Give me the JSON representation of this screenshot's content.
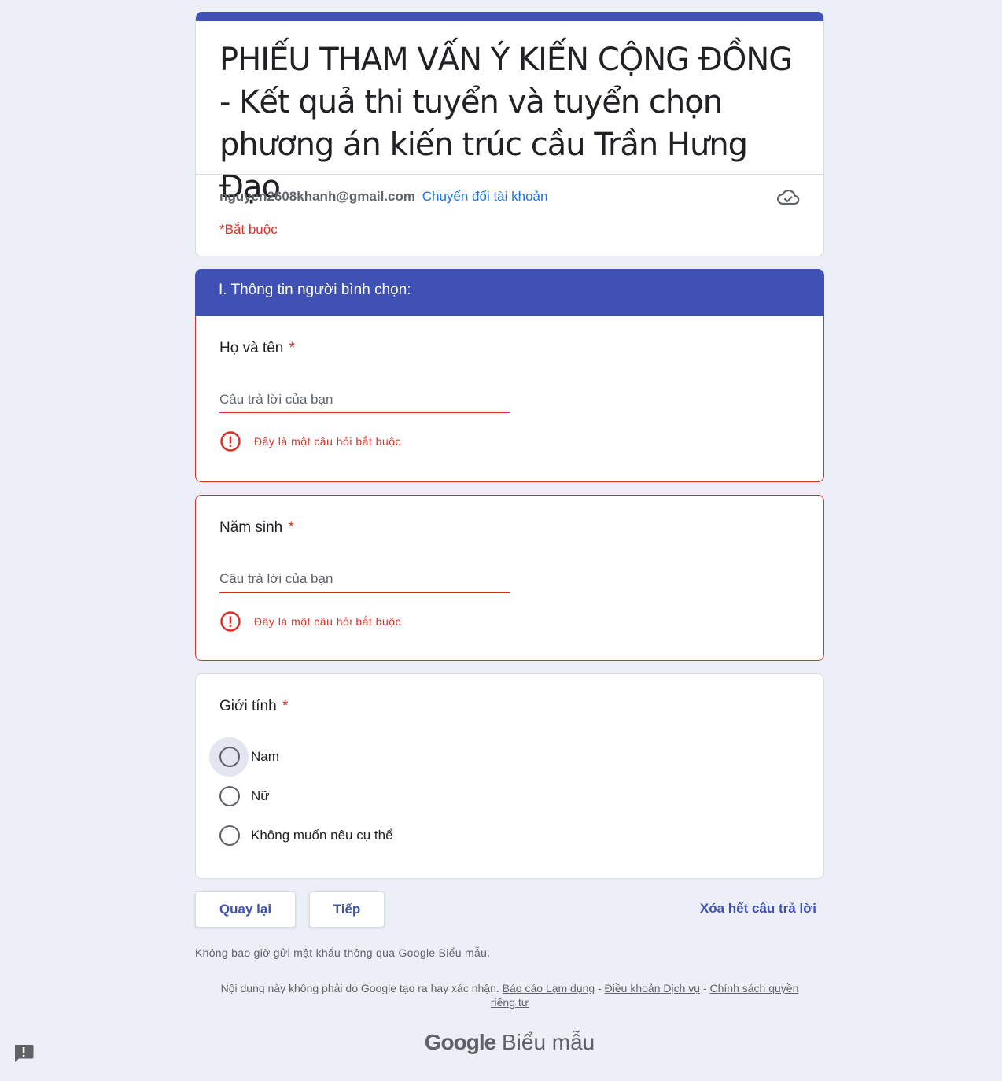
{
  "header": {
    "title": "PHIẾU THAM VẤN Ý KIẾN CỘNG ĐỒNG - Kết quả thi tuyển và tuyển chọn phương án kiến trúc cầu Trần Hưng Đạo",
    "account_email": "nguyen2608khanh@gmail.com",
    "switch_account": "Chuyển đổi tài khoản",
    "required_note": "*Bắt buộc",
    "cloud_icon": "cloud-check-icon"
  },
  "section": {
    "title": "I. Thông tin người bình chọn:"
  },
  "questions": [
    {
      "title": "Họ và tên",
      "required_mark": "*",
      "placeholder": "Câu trả lời của bạn",
      "value": "",
      "error": "Đây là một câu hỏi bắt buộc"
    },
    {
      "title": "Năm sinh",
      "required_mark": "*",
      "placeholder": "Câu trả lời của bạn",
      "value": "",
      "error": "Đây là một câu hỏi bắt buộc"
    },
    {
      "title": "Giới tính",
      "required_mark": "*",
      "options": [
        "Nam",
        "Nữ",
        "Không muốn nêu cụ thể"
      ]
    }
  ],
  "buttons": {
    "back": "Quay lại",
    "next": "Tiếp",
    "clear": "Xóa hết câu trả lời"
  },
  "footer": {
    "password_note": "Không bao giờ gửi mật khẩu thông qua Google Biểu mẫu.",
    "disclaimer": "Nội dung này không phải do Google tạo ra hay xác nhận.",
    "report_abuse": "Báo cáo Lạm dụng",
    "terms": "Điều khoản Dịch vụ",
    "privacy": "Chính sách quyền riêng tư",
    "separator": " - ",
    "brand_google": "Google",
    "brand_product": "Biểu mẫu"
  },
  "colors": {
    "accent": "#3f51b5",
    "error": "#d93025",
    "link": "#1a73e8",
    "background": "#eceef8"
  },
  "icons": {
    "error": "error-circle-icon",
    "feedback": "feedback-icon"
  }
}
